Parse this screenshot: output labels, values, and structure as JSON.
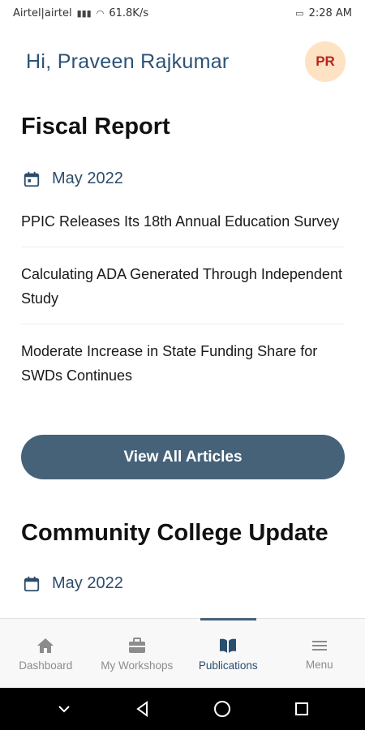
{
  "status_bar": {
    "carrier": "Airtel|airtel",
    "network": "61.8K/s",
    "time": "2:28 AM"
  },
  "header": {
    "greeting": "Hi, Praveen Rajkumar",
    "avatar_initials": "PR"
  },
  "section1": {
    "title": "Fiscal Report",
    "date": "May 2022",
    "articles": [
      "PPIC Releases Its 18th Annual Education Survey",
      "Calculating ADA Generated Through Independent Study",
      "Moderate Increase in State Funding Share for SWDs Continues"
    ],
    "button_label": "View All Articles"
  },
  "section2": {
    "title": "Community College Update",
    "date": "May 2022"
  },
  "bottom_nav": {
    "items": [
      {
        "label": "Dashboard",
        "icon": "home-icon"
      },
      {
        "label": "My Workshops",
        "icon": "briefcase-icon"
      },
      {
        "label": "Publications",
        "icon": "book-icon"
      },
      {
        "label": "Menu",
        "icon": "hamburger-icon"
      }
    ],
    "active": "Publications"
  },
  "colors": {
    "accent": "#456279",
    "greeting": "#2c5276",
    "avatar_bg": "#fde2c4",
    "avatar_text": "#b3261e"
  }
}
